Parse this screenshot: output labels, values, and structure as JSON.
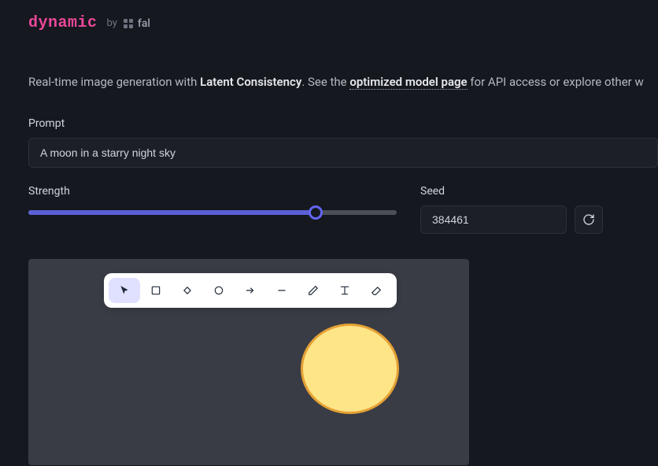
{
  "header": {
    "logo": "dynamic",
    "by": "by",
    "fal": "fal"
  },
  "intro": {
    "prefix": "Real-time image generation with ",
    "strong": "Latent Consistency",
    "mid": ". See the ",
    "link": "optimized model page",
    "suffix": " for API access or explore other w"
  },
  "prompt": {
    "label": "Prompt",
    "value": "A moon in a starry night sky"
  },
  "strength": {
    "label": "Strength",
    "value": 0.78
  },
  "seed": {
    "label": "Seed",
    "value": "384461"
  },
  "tools": {
    "select": "select",
    "rectangle": "rectangle",
    "diamond": "diamond",
    "circle": "circle",
    "arrow": "arrow",
    "line": "line",
    "pencil": "pencil",
    "text": "text",
    "eraser": "eraser"
  }
}
